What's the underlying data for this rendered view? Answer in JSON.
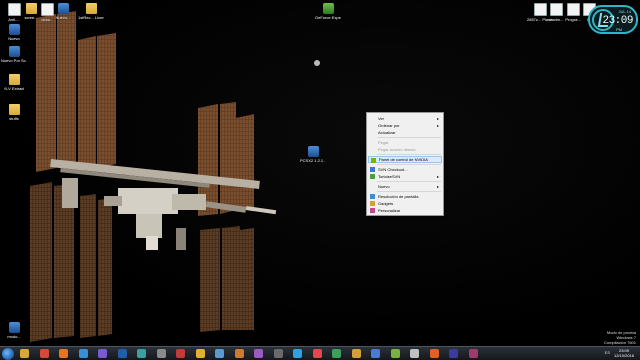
{
  "desktop": {
    "left_icons": [
      {
        "label": "Anti-...",
        "kind": "file"
      },
      {
        "label": "scree...",
        "kind": "folder"
      },
      {
        "label": "pictur...",
        "kind": "file"
      },
      {
        "label": "Nuevo...",
        "kind": "app"
      },
      {
        "label": "1stRec... Licen...",
        "kind": "folder"
      },
      {
        "label": "Nuevo",
        "kind": "app"
      },
      {
        "label": "Nuevo Por Sc...",
        "kind": "app"
      },
      {
        "label": "YLV Extract",
        "kind": "folder"
      },
      {
        "label": "stuffs",
        "kind": "folder"
      },
      {
        "label": "modo...",
        "kind": "app"
      }
    ],
    "top_icons": [
      {
        "label": "GeForce Experi...",
        "kind": "green"
      }
    ],
    "right_icons": [
      {
        "label": "2857z... Planet...",
        "kind": "file"
      },
      {
        "label": "readm...",
        "kind": "file"
      },
      {
        "label": "Progra...",
        "kind": "file"
      },
      {
        "label": "lol",
        "kind": "file"
      }
    ],
    "center_icon": {
      "label": "PCSX2 1.2.1 ...",
      "kind": "app"
    }
  },
  "clock_widget": {
    "date": "JUL 14",
    "time": "23:09",
    "ampm": "PM"
  },
  "context_menu": {
    "items": [
      {
        "label": "Ver",
        "submenu": true,
        "disabled": false,
        "highlighted": false,
        "icon": ""
      },
      {
        "label": "Ordenar por",
        "submenu": true,
        "disabled": false,
        "highlighted": false,
        "icon": ""
      },
      {
        "label": "Actualizar",
        "submenu": false,
        "disabled": false,
        "highlighted": false,
        "icon": ""
      },
      {
        "sep": true
      },
      {
        "label": "Pegar",
        "submenu": false,
        "disabled": true,
        "highlighted": false,
        "icon": ""
      },
      {
        "label": "Pegar acceso directo",
        "submenu": false,
        "disabled": true,
        "highlighted": false,
        "icon": ""
      },
      {
        "sep": true
      },
      {
        "label": "Panel de control de NVIDIA",
        "submenu": false,
        "disabled": false,
        "highlighted": true,
        "icon": "nvidia-icon"
      },
      {
        "sep": true
      },
      {
        "label": "SVN Checkout...",
        "submenu": false,
        "disabled": false,
        "highlighted": false,
        "icon": "svn-icon"
      },
      {
        "label": "TortoiseSVN",
        "submenu": true,
        "disabled": false,
        "highlighted": false,
        "icon": "tortoise-icon"
      },
      {
        "sep": true
      },
      {
        "label": "Nuevo",
        "submenu": true,
        "disabled": false,
        "highlighted": false,
        "icon": ""
      },
      {
        "sep": true
      },
      {
        "label": "Resolución de pantalla",
        "submenu": false,
        "disabled": false,
        "highlighted": false,
        "icon": "display-icon"
      },
      {
        "label": "Gadgets",
        "submenu": false,
        "disabled": false,
        "highlighted": false,
        "icon": "gadgets-icon"
      },
      {
        "label": "Personalizar",
        "submenu": false,
        "disabled": false,
        "highlighted": false,
        "icon": "personalize-icon"
      }
    ]
  },
  "watermark": {
    "line1": "Modo de prueba",
    "line2": "Windows 7",
    "line3": "Compilación 7601"
  },
  "taskbar": {
    "apps": [
      {
        "icon": "explorer-icon",
        "color": "#d9a83a"
      },
      {
        "icon": "chrome-icon",
        "color": "#d44a3a"
      },
      {
        "icon": "firefox-icon",
        "color": "#e8741f"
      },
      {
        "icon": "media-icon",
        "color": "#3a8fd4"
      },
      {
        "icon": "game-icon",
        "color": "#7a5ad0"
      },
      {
        "icon": "photoshop-icon",
        "color": "#1f5fa8"
      },
      {
        "icon": "app-icon",
        "color": "#3aa0a0"
      },
      {
        "icon": "app-icon",
        "color": "#8a8a8a"
      },
      {
        "icon": "app-icon",
        "color": "#c23a3a"
      },
      {
        "icon": "app-icon",
        "color": "#e0b030"
      },
      {
        "icon": "app-icon",
        "color": "#5a9ad0"
      },
      {
        "icon": "app-icon",
        "color": "#d07a30"
      },
      {
        "icon": "app-icon",
        "color": "#9a5ac0"
      },
      {
        "icon": "app-icon",
        "color": "#6a6a6a"
      },
      {
        "icon": "app-icon",
        "color": "#2fa0e0"
      },
      {
        "icon": "app-icon",
        "color": "#e04a4a"
      },
      {
        "icon": "app-icon",
        "color": "#3aa05a"
      },
      {
        "icon": "app-icon",
        "color": "#d4a03a"
      },
      {
        "icon": "app-icon",
        "color": "#4a7ad4"
      },
      {
        "icon": "app-icon",
        "color": "#7ab040"
      },
      {
        "icon": "app-icon",
        "color": "#c0c0c0"
      },
      {
        "icon": "app-icon",
        "color": "#e0602a"
      },
      {
        "icon": "app-icon",
        "color": "#3a3aa0"
      },
      {
        "icon": "app-icon",
        "color": "#a03a6a"
      }
    ],
    "tray_lang": "ES",
    "clock_time": "23:09",
    "clock_date": "12/10/2016"
  }
}
